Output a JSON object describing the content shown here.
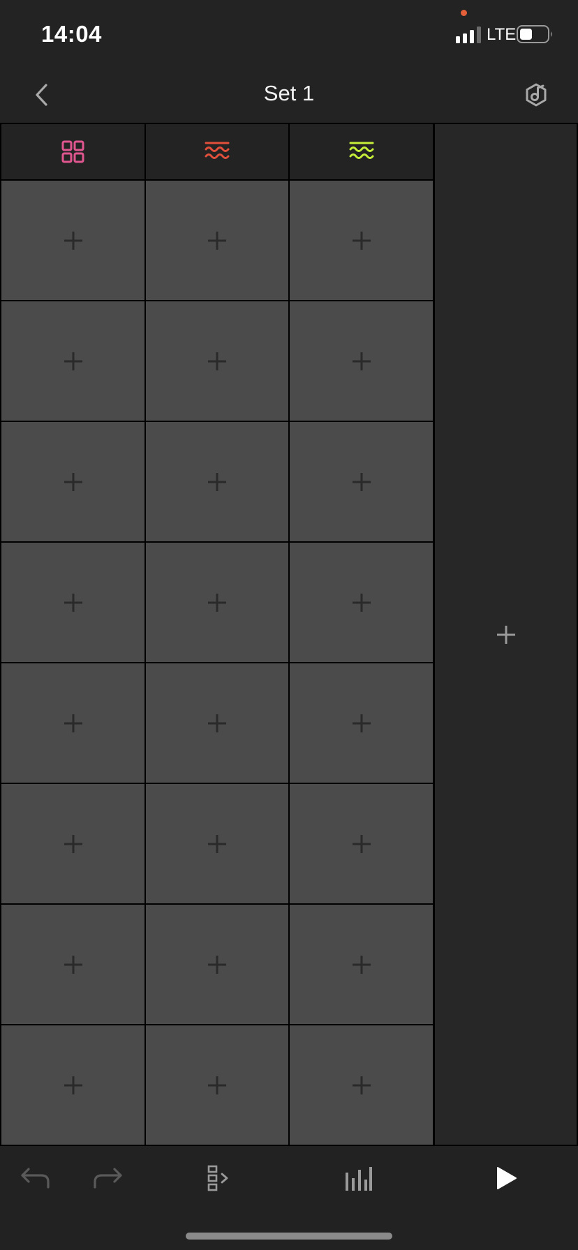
{
  "status_bar": {
    "time": "14:04",
    "network": "LTE",
    "recording_indicator_color": "#e5603a"
  },
  "nav": {
    "title": "Set 1",
    "back_icon": "chevron-left-icon",
    "settings_icon": "hexagon-note-icon"
  },
  "tracks": [
    {
      "icon": "drum-rack-grid-icon",
      "color": "#e0568f"
    },
    {
      "icon": "synth-wave-icon",
      "color": "#e2503c"
    },
    {
      "icon": "synth-wave-icon",
      "color": "#c6ef3a"
    }
  ],
  "scenes_count": 8,
  "clip_slot_icon": "plus-icon",
  "add_track_icon": "plus-icon",
  "toolbar": {
    "undo_icon": "undo-icon",
    "redo_icon": "redo-icon",
    "arrangement_icon": "scene-list-icon",
    "mixer_icon": "mixer-bars-icon",
    "play_icon": "play-icon"
  },
  "colors": {
    "background": "#232323",
    "clip_slot": "#4b4b4b",
    "grid_line": "#000000",
    "plus": "#2a2a2a",
    "toolbar_disabled": "#5a5a5a",
    "toolbar_enabled": "#9a9a9a"
  }
}
